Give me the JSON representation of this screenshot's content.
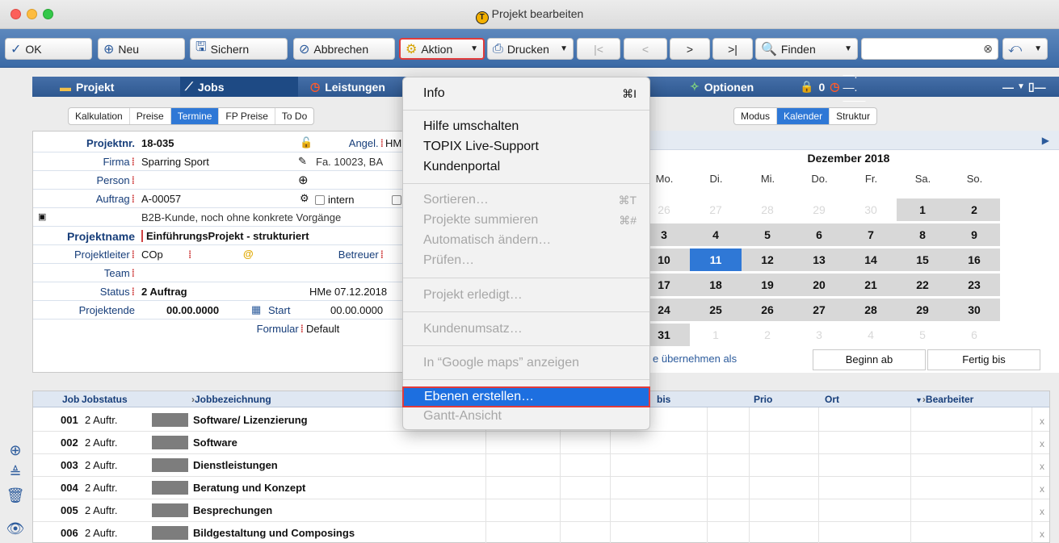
{
  "window": {
    "title": "Projekt bearbeiten"
  },
  "toolbar": {
    "ok": "OK",
    "neu": "Neu",
    "sichern": "Sichern",
    "abbrechen": "Abbrechen",
    "aktion": "Aktion",
    "drucken": "Drucken",
    "finden": "Finden"
  },
  "tabs": [
    "Projekt",
    "Jobs",
    "Leistungen",
    "Optionen"
  ],
  "tab_counter": "0",
  "tab_dots": "—.—.——",
  "subtabs": [
    "Kalkulation",
    "Preise",
    "Termine",
    "FP Preise",
    "To Do"
  ],
  "view_tabs": [
    "Modus",
    "Kalender",
    "Struktur"
  ],
  "form": {
    "projektnr_label": "Projektnr.",
    "projektnr": "18-035",
    "angel_label": "Angel.",
    "angel_value": "HM",
    "firma_label": "Firma",
    "firma": "Sparring Sport",
    "firma_extra": "Fa. 10023, BA",
    "person_label": "Person",
    "auftrag_label": "Auftrag",
    "auftrag": "A-00057",
    "intern": "intern",
    "b2b_note": "B2B-Kunde, noch ohne konkrete Vorgänge",
    "projektname_label": "Projektname",
    "projektname": "EinführungsProjekt - strukturiert",
    "projektleiter_label": "Projektleiter",
    "projektleiter": "COp",
    "betreuer_label": "Betreuer",
    "team_label": "Team",
    "status_label": "Status",
    "status": "2 Auftrag",
    "status_info": "HMe 07.12.2018",
    "projektende_label": "Projektende",
    "projektende": "00.00.0000",
    "start_label": "Start",
    "start": "00.00.0000",
    "formular_label": "Formular",
    "formular": "Default"
  },
  "calendar": {
    "month": "Dezember 2018",
    "dow": [
      "Mo.",
      "Di.",
      "Mi.",
      "Do.",
      "Fr.",
      "Sa.",
      "So."
    ],
    "weeks": [
      [
        "26",
        "27",
        "28",
        "29",
        "30",
        "1",
        "2"
      ],
      [
        "3",
        "4",
        "5",
        "6",
        "7",
        "8",
        "9"
      ],
      [
        "10",
        "11",
        "12",
        "13",
        "14",
        "15",
        "16"
      ],
      [
        "17",
        "18",
        "19",
        "20",
        "21",
        "22",
        "23"
      ],
      [
        "24",
        "25",
        "26",
        "27",
        "28",
        "29",
        "30"
      ],
      [
        "31",
        "1",
        "2",
        "3",
        "4",
        "5",
        "6"
      ]
    ],
    "today": "11",
    "uebernehmen": "e übernehmen als",
    "beginn": "Beginn ab",
    "fertig": "Fertig bis"
  },
  "menu": {
    "info": "Info",
    "info_sc": "⌘I",
    "hilfe": "Hilfe umschalten",
    "live": "TOPIX Live-Support",
    "portal": "Kundenportal",
    "sortieren": "Sortieren…",
    "sortieren_sc": "⌘T",
    "summieren": "Projekte summieren",
    "summieren_sc": "⌘#",
    "automatisch": "Automatisch ändern…",
    "pruefen": "Prüfen…",
    "erledigt": "Projekt erledigt…",
    "umsatz": "Kundenumsatz…",
    "maps": "In “Google maps” anzeigen",
    "ebenen": "Ebenen erstellen…",
    "gantt": "Gantt-Ansicht"
  },
  "table": {
    "headers": {
      "job": "Job",
      "jobstatus": "Jobstatus",
      "bez": "Jobbezeichnung",
      "bis": "bis",
      "prio": "Prio",
      "ort": "Ort",
      "bearbeiter": "Bearbeiter"
    },
    "rows": [
      {
        "job": "001",
        "status": "2 Auftr.",
        "name": "Software/ Lizenzierung"
      },
      {
        "job": "002",
        "status": "2 Auftr.",
        "name": "Software"
      },
      {
        "job": "003",
        "status": "2 Auftr.",
        "name": "Dienstleistungen"
      },
      {
        "job": "004",
        "status": "2 Auftr.",
        "name": "Beratung und Konzept"
      },
      {
        "job": "005",
        "status": "2 Auftr.",
        "name": "Besprechungen"
      },
      {
        "job": "006",
        "status": "2 Auftr.",
        "name": "Bildgestaltung und Composings"
      }
    ]
  }
}
